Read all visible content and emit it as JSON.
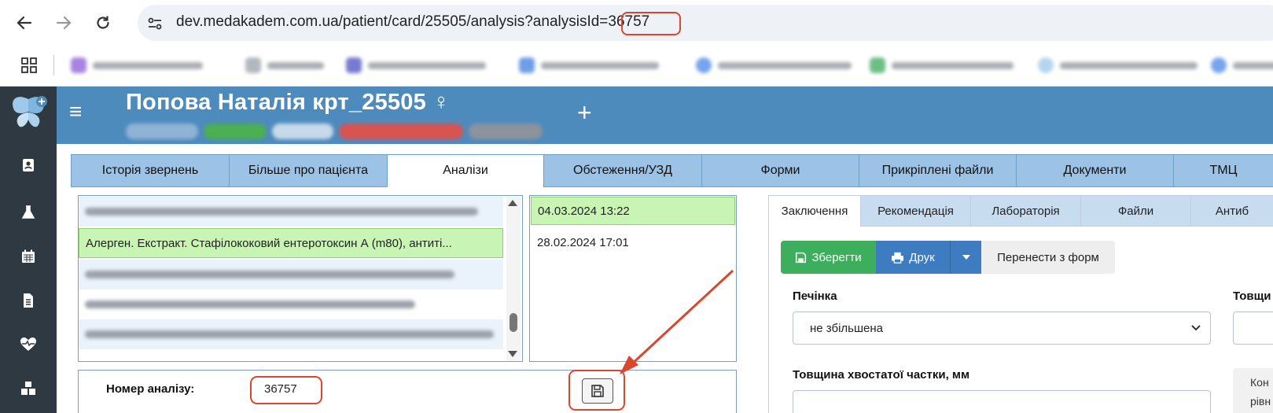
{
  "browser": {
    "url": "dev.medakadem.com.ua/patient/card/25505/analysis?analysisId=36757",
    "icons": [
      "back-arrow-icon",
      "forward-arrow-icon",
      "reload-icon",
      "site-settings-icon",
      "apps-grid-icon"
    ]
  },
  "header": {
    "patient_name": "Попова Наталія крт_25505 ♀",
    "add_symbol": "+",
    "menu_icon": "≡"
  },
  "tabs": [
    {
      "label": "Історія звернень"
    },
    {
      "label": "Більше про пацієнта"
    },
    {
      "label": "Аналізи"
    },
    {
      "label": "Обстеження/УЗД"
    },
    {
      "label": "Форми"
    },
    {
      "label": "Прикріплені файли"
    },
    {
      "label": "Документи"
    },
    {
      "label": "ТМЦ"
    }
  ],
  "analysis_list": {
    "selected_item": "Алерген. Екстракт. Стафілококовий ентеротоксин А (m80), антиті..."
  },
  "dates": [
    "04.03.2024 13:22",
    "28.02.2024 17:01"
  ],
  "analysis_number": {
    "label": "Номер аналізу:",
    "value": "36757"
  },
  "right_tabs": [
    {
      "label": "Заключення"
    },
    {
      "label": "Рекомендація"
    },
    {
      "label": "Лабораторія"
    },
    {
      "label": "Файли"
    },
    {
      "label": "Антиб"
    }
  ],
  "toolbar": {
    "save_label": "Зберегти",
    "print_label": "Друк",
    "transfer_label": "Перенести з форм"
  },
  "form": {
    "liver_label": "Печінка",
    "liver_value": "не збільшена",
    "thickness_label": "Товщи",
    "caudate_label": "Товщина хвостатої частки, мм",
    "side_note_1": "Кон",
    "side_note_2": "рівн"
  },
  "colors": {
    "header_blue": "#4e8bbd",
    "tab_blue": "#9cc3e6",
    "selected_green": "#c9f5b4",
    "save_green": "#3cae5c",
    "print_blue": "#3e7cc2",
    "highlight_red": "#d9472f",
    "sidebar_dark": "#2f3942"
  }
}
